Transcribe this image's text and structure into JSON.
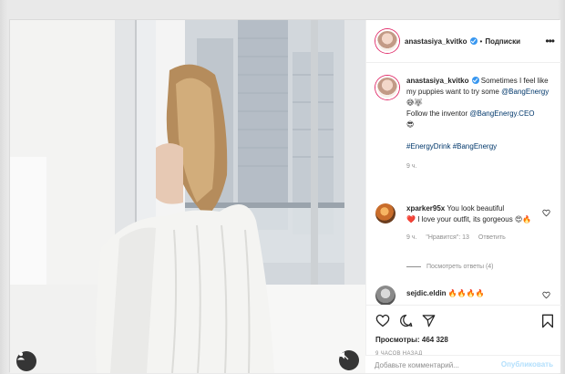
{
  "post": {
    "username": "anastasiya_kvitko",
    "separator": "•",
    "follow_label": "Подписки",
    "more_label": "•••"
  },
  "caption": {
    "username": "anastasiya_kvitko",
    "text_1": "Sometimes I feel like my puppies want to try some",
    "mention_1": "@BangEnergy",
    "emoji_1": "😅🐺",
    "text_2": "Follow the inventor",
    "mention_2": "@BangEnergy.CEO",
    "emoji_2": "😎",
    "hashtags": "#EnergyDrink #BangEnergy",
    "time": "9 ч."
  },
  "comments": [
    {
      "username": "xparker95x",
      "text": "You look beautiful",
      "emoji_heart": "❤️",
      "text_2": "I love your outfit, its gorgeous",
      "emoji_end": "😍🔥",
      "time": "9 ч.",
      "likes": "\"Нравится\": 13",
      "reply": "Ответить",
      "view_replies": "Посмотреть ответы (4)"
    },
    {
      "username": "sejdic.eldin",
      "text": "",
      "emoji_end": "🔥🔥🔥🔥"
    }
  ],
  "stats": {
    "views_label": "Просмотры:",
    "views_count": "464 328",
    "posted": "9 ЧАСОВ НАЗАД"
  },
  "composer": {
    "placeholder": "Добавьте комментарий...",
    "publish_label": "Опубликовать"
  },
  "colors": {
    "accent": "#3897f0",
    "publish_disabled": "#b2dffc",
    "muted": "#8e8e8e",
    "like_red": "#ed4956"
  }
}
